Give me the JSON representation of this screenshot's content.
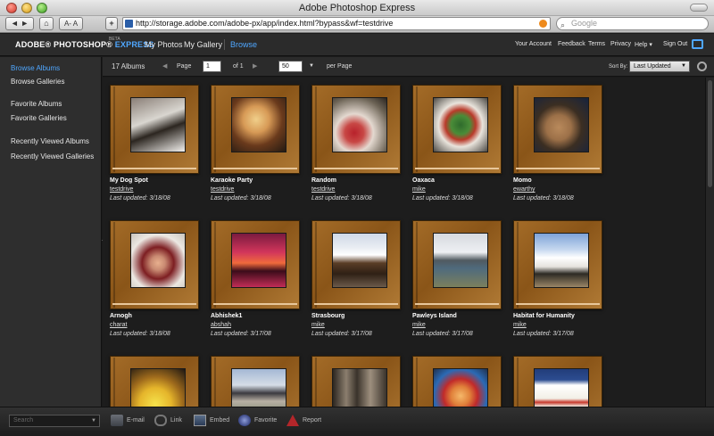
{
  "window": {
    "title": "Adobe Photoshop Express"
  },
  "browser": {
    "back_label": "◄ ►",
    "textsize_label": "A‑ A",
    "new_tab_label": "+",
    "url": "http://storage.adobe.com/adobe-px/app/index.html?bypass&wf=testdrive",
    "search_placeholder": "Google"
  },
  "app": {
    "brand_prefix": "ADOBE® PHOTOSHOP® ",
    "brand_express": "EXPRESS",
    "beta": "BETA",
    "nav": [
      {
        "label": "My Photos"
      },
      {
        "label": "My Gallery"
      },
      {
        "label": "Browse"
      }
    ],
    "right_nav": [
      {
        "label": "Your Account"
      },
      {
        "label": "Feedback"
      },
      {
        "label": "Terms"
      },
      {
        "label": "Privacy"
      },
      {
        "label": "Help ▾"
      },
      {
        "label": "Sign Out"
      }
    ]
  },
  "sidebar": {
    "items": [
      {
        "label": "Browse Albums"
      },
      {
        "label": "Browse Galleries"
      },
      {
        "label": "Favorite Albums"
      },
      {
        "label": "Favorite Galleries"
      },
      {
        "label": "Recently Viewed Albums"
      },
      {
        "label": "Recently Viewed Galleries"
      }
    ]
  },
  "toolbar": {
    "album_count": "17 Albums",
    "page_label": "Page",
    "page_value": "1",
    "of_label": "of 1",
    "per_page_value": "50",
    "per_page_label": "per Page",
    "sort_label": "Sort By:",
    "sort_value": "Last Updated"
  },
  "albums": [
    {
      "title": "My Dog Spot",
      "owner": "testdrive",
      "updated": "Last updated: 3/18/08"
    },
    {
      "title": "Karaoke Party",
      "owner": "testdrive",
      "updated": "Last updated: 3/18/08"
    },
    {
      "title": "Random",
      "owner": "testdrive",
      "updated": "Last updated: 3/18/08"
    },
    {
      "title": "Oaxaca",
      "owner": "mike",
      "updated": "Last updated: 3/18/08"
    },
    {
      "title": "Momo",
      "owner": "ewarthy",
      "updated": "Last updated: 3/18/08"
    },
    {
      "title": "Arnogh",
      "owner": "charat",
      "updated": "Last updated: 3/18/08"
    },
    {
      "title": "Abhishek1",
      "owner": "abshah",
      "updated": "Last updated: 3/17/08"
    },
    {
      "title": "Strasbourg",
      "owner": "mike",
      "updated": "Last updated: 3/17/08"
    },
    {
      "title": "Pawleys Island",
      "owner": "mike",
      "updated": "Last updated: 3/17/08"
    },
    {
      "title": "Habitat for Humanity",
      "owner": "mike",
      "updated": "Last updated: 3/17/08"
    },
    {
      "title": "",
      "owner": "",
      "updated": ""
    },
    {
      "title": "",
      "owner": "",
      "updated": ""
    },
    {
      "title": "",
      "owner": "",
      "updated": ""
    },
    {
      "title": "",
      "owner": "",
      "updated": ""
    },
    {
      "title": "",
      "owner": "",
      "updated": ""
    }
  ],
  "footer": {
    "search_placeholder": "Search",
    "actions": [
      {
        "label": "E-mail",
        "icon": "email-icon"
      },
      {
        "label": "Link",
        "icon": "link-icon"
      },
      {
        "label": "Embed",
        "icon": "embed-icon"
      },
      {
        "label": "Favorite",
        "icon": "favorite-icon"
      },
      {
        "label": "Report",
        "icon": "report-icon"
      }
    ]
  }
}
